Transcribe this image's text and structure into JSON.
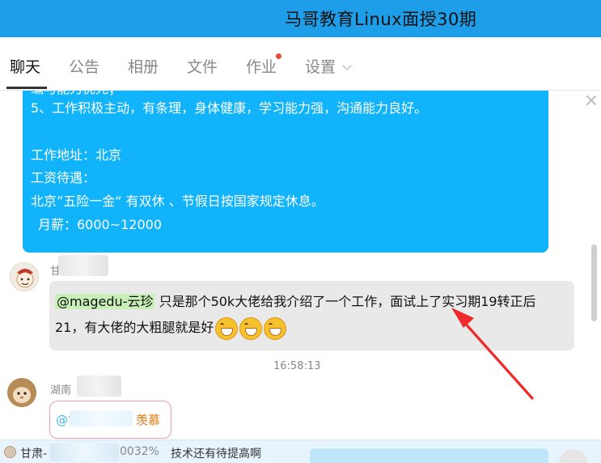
{
  "window": {
    "title": "马哥教育Linux面授30期",
    "accent": "#1e9ee8"
  },
  "tabs": [
    {
      "label": "聊天",
      "active": true
    },
    {
      "label": "公告"
    },
    {
      "label": "相册"
    },
    {
      "label": "文件"
    },
    {
      "label": "作业",
      "has_dot": true
    },
    {
      "label": "设置",
      "has_dropdown": true
    }
  ],
  "messages": {
    "job_post": {
      "lines": [
        "编与能力优先；",
        "5、工作积极主动，有条理，身体健康，学习能力强，沟通能力良好。",
        "工作地址：北京",
        "工资待遇：",
        "北京”五险一金“  有双休 、节假日按国家规定休息。",
        "月薪：6000~12000"
      ],
      "color": "#11b4fa"
    },
    "reply": {
      "sender": "甘",
      "mention": "@magedu-云珍",
      "line1": "只是那个50k大佬给我介绍了一个工作，面试上了实习期19转正后",
      "line2": "21，有大佬的大粗腿就是好",
      "emoji": "grin-face",
      "emoji_count": 3
    },
    "timestamp": "16:58:13",
    "comment": {
      "sender": "湖南",
      "mention": "@甘",
      "text": "羡慕"
    }
  },
  "bottom_bar": {
    "sender": "甘肃-",
    "partial_id": "0032%",
    "text": "技术还有待提高啊"
  },
  "annotation": {
    "type": "red-arrow",
    "color": "#ee2a2a"
  }
}
